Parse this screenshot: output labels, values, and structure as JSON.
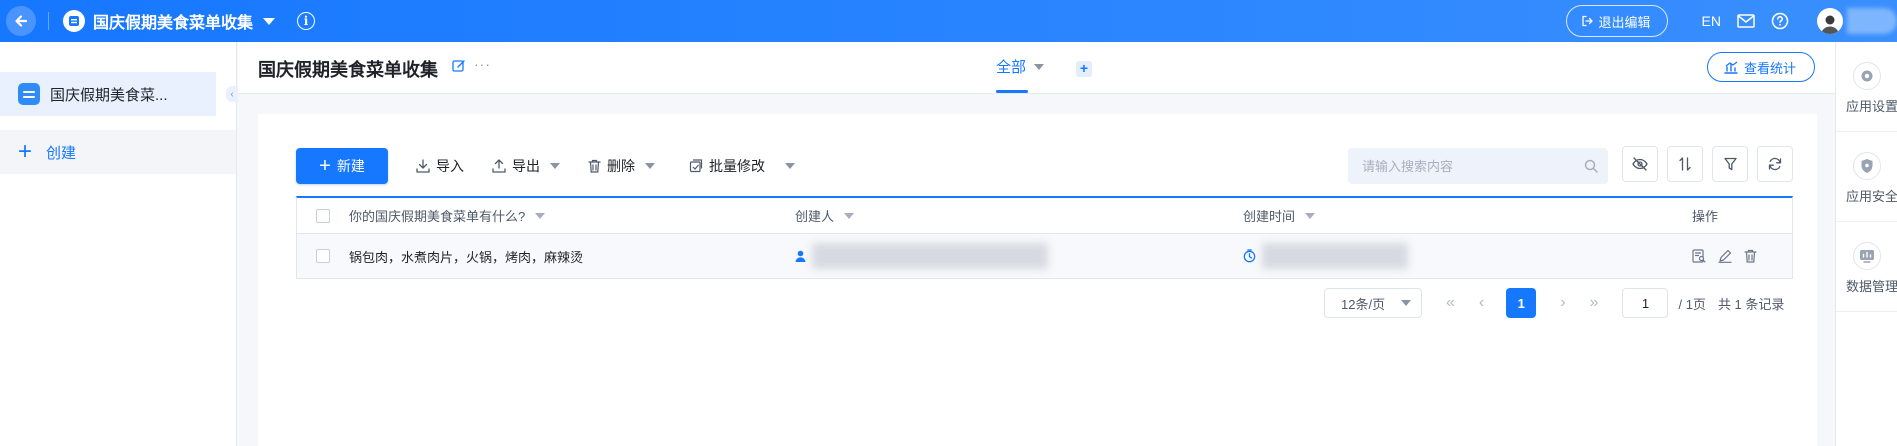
{
  "topbar": {
    "app_title": "国庆假期美食菜单收集",
    "exit_edit": "退出编辑",
    "language": "EN"
  },
  "sidebar": {
    "form_item": "国庆假期美食菜...",
    "create_label": "创建"
  },
  "header": {
    "page_title": "国庆假期美食菜单收集",
    "more": "···",
    "tab_all": "全部",
    "tab_add": "+",
    "stats_button": "查看统计"
  },
  "toolbar": {
    "new": "新建",
    "import": "导入",
    "export": "导出",
    "delete": "删除",
    "batch_edit": "批量修改",
    "search_placeholder": "请输入搜索内容"
  },
  "table": {
    "columns": [
      "你的国庆假期美食菜单有什么?",
      "创建人",
      "创建时间",
      "操作"
    ],
    "rows": [
      {
        "answer": "锅包肉，水煮肉片，火锅，烤肉，麻辣烫"
      }
    ]
  },
  "pagination": {
    "page_size": "12条/页",
    "current_page": "1",
    "jump_value": "1",
    "total_pages": "/ 1页",
    "total_records": "共 1 条记录"
  },
  "right_rail": {
    "items": [
      "应用设置",
      "应用安全",
      "数据管理"
    ]
  },
  "colors": {
    "primary": "#1677ff",
    "topbar": "#2b86ff",
    "nav_active_bg": "#e8f1fd"
  }
}
